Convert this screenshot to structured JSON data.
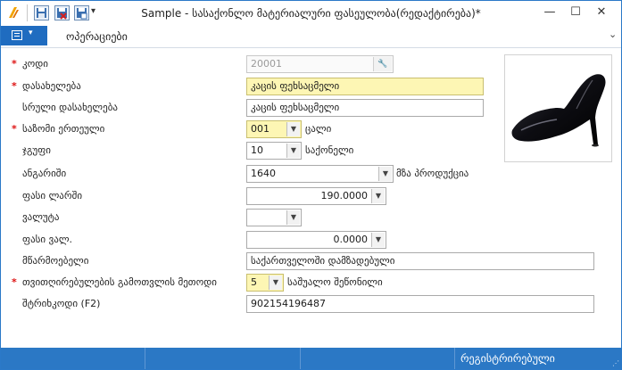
{
  "window": {
    "title": "Sample - სასაქონლო მატერიალური ფასეულობა(რედაქტირება)*",
    "minimize": "—",
    "maximize": "☐",
    "close": "✕"
  },
  "ribbon": {
    "menu_caret": "▾",
    "tab_operations": "ოპერაციები",
    "collapse_chevron": "⌄"
  },
  "form": {
    "code": {
      "label": "კოდი",
      "value": "20001",
      "required": true
    },
    "name": {
      "label": "დასახელება",
      "value": "კაცის ფეხსაცმელი",
      "required": true
    },
    "full_name": {
      "label": "სრული დასახელება",
      "value": "კაცის ფეხსაცმელი",
      "required": false
    },
    "unit": {
      "label": "საზომი ერთეული",
      "value": "001",
      "suffix": "ცალი",
      "required": true
    },
    "group": {
      "label": "ჯგუფი",
      "value": "10",
      "suffix": "საქონელი",
      "required": false
    },
    "account": {
      "label": "ანგარიში",
      "value": "1640",
      "suffix": "მზა პროდუქცია",
      "required": false
    },
    "price_gel": {
      "label": "ფასი ლარში",
      "value": "190.0000",
      "required": false
    },
    "currency": {
      "label": "ვალუტა",
      "value": "",
      "required": false
    },
    "price_cur": {
      "label": "ფასი ვალ.",
      "value": "0.0000",
      "required": false
    },
    "manufacturer": {
      "label": "მწარმოებელი",
      "value": "საქართველოში დამზადებული",
      "required": false
    },
    "cost_method": {
      "label": "თვითღირებულების გამოთვლის მეთოდი",
      "value": "5",
      "suffix": "საშუალო შეწონილი",
      "required": true
    },
    "barcode": {
      "label": "შტრიხკოდი (F2)",
      "value": "902154196487",
      "required": false
    }
  },
  "statusbar": {
    "status_text": "რეგისტრირებული"
  },
  "colors": {
    "accent": "#2b78c5",
    "required_mark": "#dd1111",
    "highlight_field": "#fdf6b4"
  }
}
